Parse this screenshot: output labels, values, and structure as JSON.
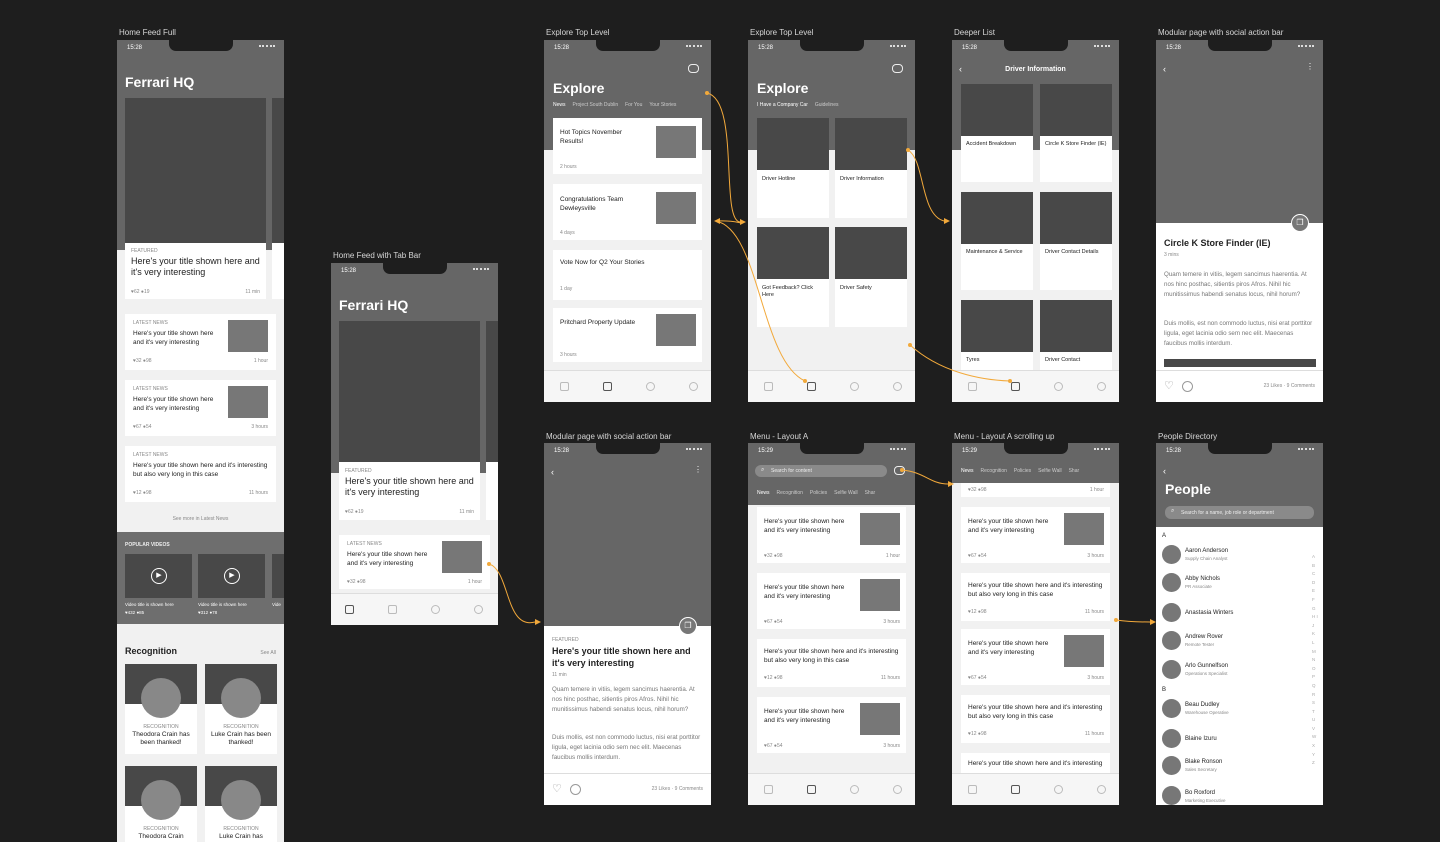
{
  "frames": {
    "home_full": "Home Feed Full",
    "home_tab": "Home Feed with Tab Bar",
    "explore1": "Explore Top Level",
    "explore2": "Explore Top Level",
    "deeper": "Deeper List",
    "modular1": "Modular page with social action bar",
    "modular2": "Modular page with social action bar",
    "menu_a": "Menu - Layout A",
    "menu_a_scroll": "Menu - Layout A scrolling up",
    "people": "People Directory"
  },
  "status_time": "15:28",
  "status_time_alt": "15:29",
  "home": {
    "title": "Ferrari HQ",
    "featured_tag": "FEATURED",
    "featured_title": "Here's your title shown here and it's very interesting",
    "featured_likes": "62",
    "featured_comments": "19",
    "featured_time": "11 min",
    "latest_tag": "LATEST NEWS",
    "latest": [
      {
        "title": "Here's your title shown here and it's very interesting",
        "likes": "32",
        "comments": "98",
        "time": "1 hour"
      },
      {
        "title": "Here's your title shown here and it's very interesting",
        "likes": "67",
        "comments": "54",
        "time": "3 hours"
      },
      {
        "title": "Here's your title shown here and it's interesting but also very long in this case",
        "likes": "12",
        "comments": "98",
        "time": "11 hours"
      }
    ],
    "see_more": "See more in Latest News",
    "videos_heading": "POPULAR VIDEOS",
    "videos": [
      {
        "title": "Video title is shown here",
        "likes": "432",
        "comments": "85"
      },
      {
        "title": "Video title is shown here",
        "likes": "312",
        "comments": "78"
      }
    ],
    "video_partial": "Vide",
    "recognition_heading": "Recognition",
    "see_all": "See All",
    "recognition_tag": "RECOGNITION",
    "recognition": [
      "Theodora Crain has been thanked!",
      "Luke Crain has been thanked!",
      "Theodora Crain",
      "Luke Crain has"
    ]
  },
  "home_tab": {
    "latest_time": "1 hour"
  },
  "explore": {
    "title": "Explore",
    "tabs": [
      "News",
      "Project South Dublin",
      "For You",
      "Your Stories"
    ],
    "items": [
      {
        "title": "Hot Topics November Results!",
        "time": "2 hours"
      },
      {
        "title": "Congratulations Team Dewleysville",
        "time": "4 days"
      },
      {
        "title": "Vote Now for Q2 Your Stories",
        "time": "1 day"
      },
      {
        "title": "Pritchard Property Update",
        "time": "3 hours"
      }
    ],
    "tabs2": [
      "I Have a Company Car",
      "Guidelines"
    ],
    "tiles": [
      "Driver Hotline",
      "Driver Information",
      "Got Feedback? Click Here",
      "Driver Safety"
    ]
  },
  "deeper": {
    "title": "Driver Information",
    "tiles": [
      "Accident Breakdown",
      "Circle K Store Finder (IE)",
      "Maintenance & Service",
      "Driver Contact Details",
      "Tyres",
      "Driver Contact"
    ]
  },
  "modular1": {
    "title": "Circle K Store Finder (IE)",
    "meta": "3 mins",
    "p1": "Quam temere in vitiis, legem sancimus haerentia. At nos hinc posthac, sitientis piros Afros. Nihil hic munitissimus habendi senatus locus, nihil horum?",
    "p2": "Duis mollis, est non commodo luctus, nisi erat porttitor ligula, eget lacinia odio sem nec elit. Maecenas faucibus mollis interdum.",
    "likes": "23 Likes",
    "comments": "9 Comments"
  },
  "modular2": {
    "tag": "FEATURED",
    "title": "Here's your title shown here and it's very interesting",
    "meta": "11 min"
  },
  "menu": {
    "search_placeholder": "Search for content",
    "tabs": [
      "News",
      "Recognition",
      "Policies",
      "Selfie Wall",
      "Shar"
    ],
    "items": [
      {
        "title": "Here's your title shown here and it's very interesting",
        "likes": "32",
        "comments": "98",
        "time": "1 hour"
      },
      {
        "title": "Here's your title shown here and it's very interesting",
        "likes": "67",
        "comments": "54",
        "time": "3 hours"
      },
      {
        "title": "Here's your title shown here and it's interesting but also very long in this case",
        "likes": "12",
        "comments": "98",
        "time": "11 hours"
      },
      {
        "title": "Here's your title shown here and it's very interesting",
        "likes": "67",
        "comments": "54",
        "time": "3 hours"
      }
    ]
  },
  "people": {
    "title": "People",
    "search_placeholder": "Search for a name, job role or department",
    "section_a": "A",
    "section_b": "B",
    "alphabet": "A B C D E F G H I J K L M N O P Q R S T U V W X Y Z",
    "list": [
      {
        "name": "Aaron Anderson",
        "role": "Supply Chain Analyst"
      },
      {
        "name": "Abby Nichols",
        "role": "PR Associate"
      },
      {
        "name": "Anastasia Winters",
        "role": ""
      },
      {
        "name": "Andrew Rover",
        "role": "Remote Tester"
      },
      {
        "name": "Arlo Gunnelfson",
        "role": "Operations Specialist"
      },
      {
        "name": "Beau Dudley",
        "role": "Warehouse Operative"
      },
      {
        "name": "Blaine Izuru",
        "role": ""
      },
      {
        "name": "Blake Ronson",
        "role": "Sales Secretary"
      },
      {
        "name": "Bo Roxford",
        "role": "Marketing Executive"
      }
    ]
  },
  "colors": {
    "accent": "#f2a93b",
    "canvas": "#1e1e1e",
    "header": "#666666"
  }
}
